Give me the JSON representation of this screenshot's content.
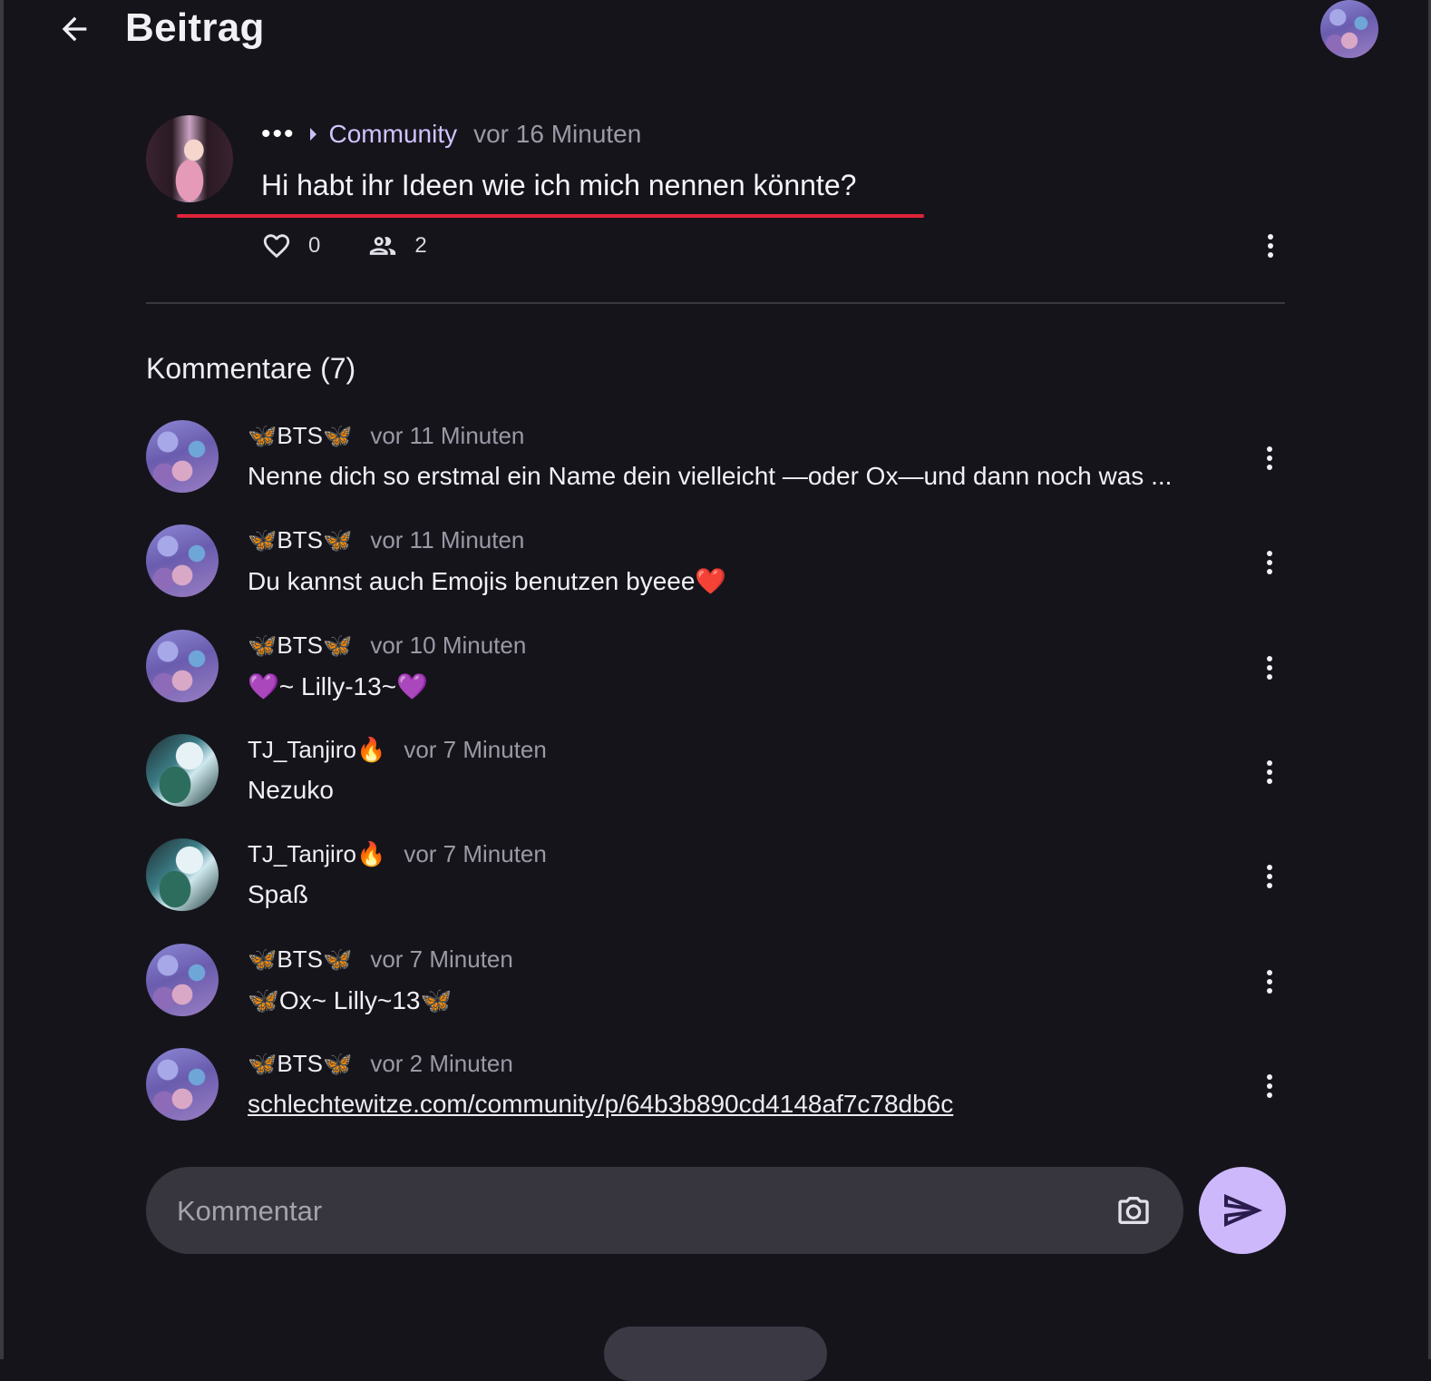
{
  "header": {
    "title": "Beitrag"
  },
  "post": {
    "more_label": "•••",
    "community": "Community",
    "time": "vor 16 Minuten",
    "title": "Hi habt ihr Ideen wie ich mich nennen könnte?",
    "likes": "0",
    "participants": "2"
  },
  "comments_heading": "Kommentare (7)",
  "comments": [
    {
      "author": "BTS",
      "butterflies": true,
      "author_emoji": "",
      "time": "vor 11 Minuten",
      "text": "Nenne dich so erstmal ein Name dein vielleicht —oder Ox—und dann noch was ...",
      "avatar": "bts"
    },
    {
      "author": "BTS",
      "butterflies": true,
      "author_emoji": "",
      "time": "vor 11 Minuten",
      "text": "Du kannst auch Emojis benutzen byeee❤️",
      "avatar": "bts"
    },
    {
      "author": "BTS",
      "butterflies": true,
      "author_emoji": "",
      "time": "vor 10 Minuten",
      "text": "💜~ Lilly-13~💜",
      "avatar": "bts"
    },
    {
      "author": "TJ_Tanjiro",
      "butterflies": false,
      "author_emoji": "🔥",
      "time": "vor 7 Minuten",
      "text": "Nezuko",
      "avatar": "tanjiro"
    },
    {
      "author": "TJ_Tanjiro",
      "butterflies": false,
      "author_emoji": "🔥",
      "time": "vor 7 Minuten",
      "text": "Spaß",
      "avatar": "tanjiro"
    },
    {
      "author": "BTS",
      "butterflies": true,
      "author_emoji": "",
      "time": "vor 7 Minuten",
      "text": "🦋Ox~ Lilly~13🦋",
      "avatar": "bts"
    },
    {
      "author": "BTS",
      "butterflies": true,
      "author_emoji": "",
      "time": "vor 2 Minuten",
      "text": "schlechtewitze.com/community/p/64b3b890cd4148af7c78db6c",
      "avatar": "bts",
      "is_link": true
    }
  ],
  "comment_input": {
    "placeholder": "Kommentar",
    "value": ""
  },
  "icons": {
    "back": "arrow-left-icon",
    "like": "heart-icon",
    "participants": "people-icon",
    "more": "more-vert-icon",
    "camera": "camera-icon",
    "send": "send-icon"
  },
  "colors": {
    "background": "#16141b",
    "accent": "#cdb8fb",
    "community_link": "#cfc3ff",
    "underline": "#e0243b",
    "butterfly": "#3fa9f5"
  }
}
